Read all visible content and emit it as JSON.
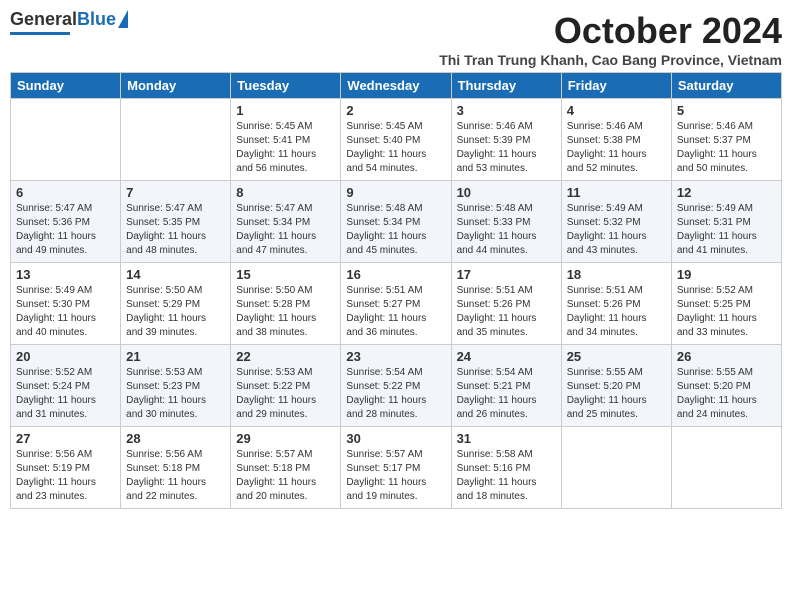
{
  "logo": {
    "general": "General",
    "blue": "Blue"
  },
  "title": "October 2024",
  "subtitle": "Thi Tran Trung Khanh, Cao Bang Province, Vietnam",
  "days_of_week": [
    "Sunday",
    "Monday",
    "Tuesday",
    "Wednesday",
    "Thursday",
    "Friday",
    "Saturday"
  ],
  "weeks": [
    [
      {
        "day": "",
        "info": ""
      },
      {
        "day": "",
        "info": ""
      },
      {
        "day": "1",
        "info": "Sunrise: 5:45 AM\nSunset: 5:41 PM\nDaylight: 11 hours and 56 minutes."
      },
      {
        "day": "2",
        "info": "Sunrise: 5:45 AM\nSunset: 5:40 PM\nDaylight: 11 hours and 54 minutes."
      },
      {
        "day": "3",
        "info": "Sunrise: 5:46 AM\nSunset: 5:39 PM\nDaylight: 11 hours and 53 minutes."
      },
      {
        "day": "4",
        "info": "Sunrise: 5:46 AM\nSunset: 5:38 PM\nDaylight: 11 hours and 52 minutes."
      },
      {
        "day": "5",
        "info": "Sunrise: 5:46 AM\nSunset: 5:37 PM\nDaylight: 11 hours and 50 minutes."
      }
    ],
    [
      {
        "day": "6",
        "info": "Sunrise: 5:47 AM\nSunset: 5:36 PM\nDaylight: 11 hours and 49 minutes."
      },
      {
        "day": "7",
        "info": "Sunrise: 5:47 AM\nSunset: 5:35 PM\nDaylight: 11 hours and 48 minutes."
      },
      {
        "day": "8",
        "info": "Sunrise: 5:47 AM\nSunset: 5:34 PM\nDaylight: 11 hours and 47 minutes."
      },
      {
        "day": "9",
        "info": "Sunrise: 5:48 AM\nSunset: 5:34 PM\nDaylight: 11 hours and 45 minutes."
      },
      {
        "day": "10",
        "info": "Sunrise: 5:48 AM\nSunset: 5:33 PM\nDaylight: 11 hours and 44 minutes."
      },
      {
        "day": "11",
        "info": "Sunrise: 5:49 AM\nSunset: 5:32 PM\nDaylight: 11 hours and 43 minutes."
      },
      {
        "day": "12",
        "info": "Sunrise: 5:49 AM\nSunset: 5:31 PM\nDaylight: 11 hours and 41 minutes."
      }
    ],
    [
      {
        "day": "13",
        "info": "Sunrise: 5:49 AM\nSunset: 5:30 PM\nDaylight: 11 hours and 40 minutes."
      },
      {
        "day": "14",
        "info": "Sunrise: 5:50 AM\nSunset: 5:29 PM\nDaylight: 11 hours and 39 minutes."
      },
      {
        "day": "15",
        "info": "Sunrise: 5:50 AM\nSunset: 5:28 PM\nDaylight: 11 hours and 38 minutes."
      },
      {
        "day": "16",
        "info": "Sunrise: 5:51 AM\nSunset: 5:27 PM\nDaylight: 11 hours and 36 minutes."
      },
      {
        "day": "17",
        "info": "Sunrise: 5:51 AM\nSunset: 5:26 PM\nDaylight: 11 hours and 35 minutes."
      },
      {
        "day": "18",
        "info": "Sunrise: 5:51 AM\nSunset: 5:26 PM\nDaylight: 11 hours and 34 minutes."
      },
      {
        "day": "19",
        "info": "Sunrise: 5:52 AM\nSunset: 5:25 PM\nDaylight: 11 hours and 33 minutes."
      }
    ],
    [
      {
        "day": "20",
        "info": "Sunrise: 5:52 AM\nSunset: 5:24 PM\nDaylight: 11 hours and 31 minutes."
      },
      {
        "day": "21",
        "info": "Sunrise: 5:53 AM\nSunset: 5:23 PM\nDaylight: 11 hours and 30 minutes."
      },
      {
        "day": "22",
        "info": "Sunrise: 5:53 AM\nSunset: 5:22 PM\nDaylight: 11 hours and 29 minutes."
      },
      {
        "day": "23",
        "info": "Sunrise: 5:54 AM\nSunset: 5:22 PM\nDaylight: 11 hours and 28 minutes."
      },
      {
        "day": "24",
        "info": "Sunrise: 5:54 AM\nSunset: 5:21 PM\nDaylight: 11 hours and 26 minutes."
      },
      {
        "day": "25",
        "info": "Sunrise: 5:55 AM\nSunset: 5:20 PM\nDaylight: 11 hours and 25 minutes."
      },
      {
        "day": "26",
        "info": "Sunrise: 5:55 AM\nSunset: 5:20 PM\nDaylight: 11 hours and 24 minutes."
      }
    ],
    [
      {
        "day": "27",
        "info": "Sunrise: 5:56 AM\nSunset: 5:19 PM\nDaylight: 11 hours and 23 minutes."
      },
      {
        "day": "28",
        "info": "Sunrise: 5:56 AM\nSunset: 5:18 PM\nDaylight: 11 hours and 22 minutes."
      },
      {
        "day": "29",
        "info": "Sunrise: 5:57 AM\nSunset: 5:18 PM\nDaylight: 11 hours and 20 minutes."
      },
      {
        "day": "30",
        "info": "Sunrise: 5:57 AM\nSunset: 5:17 PM\nDaylight: 11 hours and 19 minutes."
      },
      {
        "day": "31",
        "info": "Sunrise: 5:58 AM\nSunset: 5:16 PM\nDaylight: 11 hours and 18 minutes."
      },
      {
        "day": "",
        "info": ""
      },
      {
        "day": "",
        "info": ""
      }
    ]
  ]
}
